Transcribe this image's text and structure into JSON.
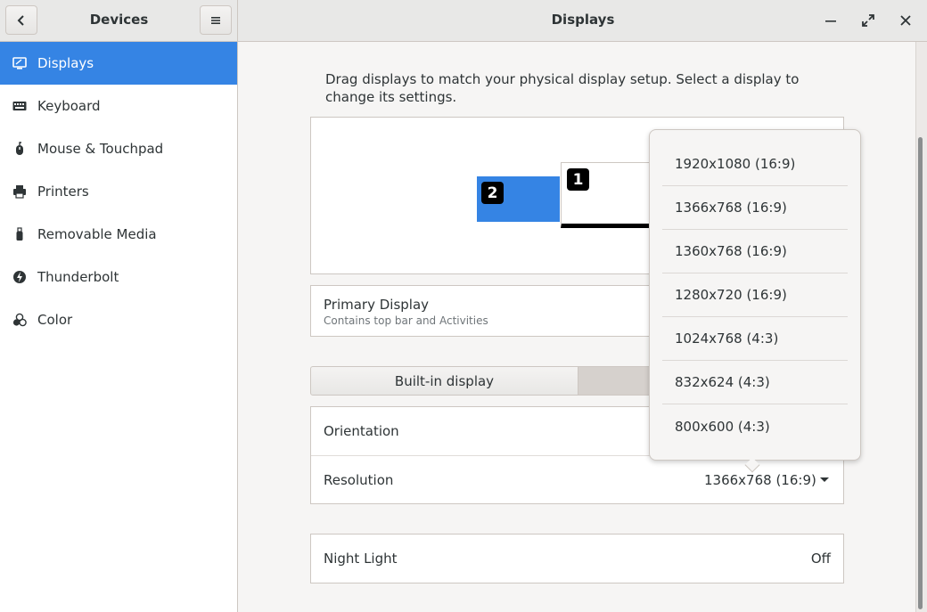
{
  "header": {
    "left_title": "Devices",
    "right_title": "Displays",
    "icons": [
      "back-arrow-icon",
      "hamburger-menu-icon",
      "minimize-icon",
      "maximize-icon",
      "close-icon"
    ]
  },
  "sidebar": {
    "items": [
      {
        "label": "Displays",
        "icon": "display-icon",
        "active": true
      },
      {
        "label": "Keyboard",
        "icon": "keyboard-icon"
      },
      {
        "label": "Mouse & Touchpad",
        "icon": "mouse-icon"
      },
      {
        "label": "Printers",
        "icon": "printer-icon"
      },
      {
        "label": "Removable Media",
        "icon": "usb-icon"
      },
      {
        "label": "Thunderbolt",
        "icon": "thunderbolt-icon"
      },
      {
        "label": "Color",
        "icon": "color-icon"
      }
    ]
  },
  "main": {
    "description": "Drag displays to match your physical display setup. Select a display to change its settings.",
    "monitors": [
      {
        "number": "2"
      },
      {
        "number": "1"
      }
    ],
    "primary_display": {
      "title": "Primary Display",
      "subtitle": "Contains top bar and Activities"
    },
    "tabs": [
      {
        "label": "Built-in display"
      }
    ],
    "settings": {
      "orientation_label": "Orientation",
      "resolution_label": "Resolution",
      "resolution_value": "1366x768 (16:9)"
    },
    "night_light": {
      "label": "Night Light",
      "value": "Off"
    }
  },
  "popover": {
    "options": [
      "1920x1080 (16:9)",
      "1366x768 (16:9)",
      "1360x768 (16:9)",
      "1280x720 (16:9)",
      "1024x768 (4:3)",
      "832x624 (4:3)",
      "800x600 (4:3)"
    ]
  },
  "colors": {
    "accent": "#3584e4",
    "headerbar": "#e8e8e7",
    "background": "#f6f5f4"
  }
}
